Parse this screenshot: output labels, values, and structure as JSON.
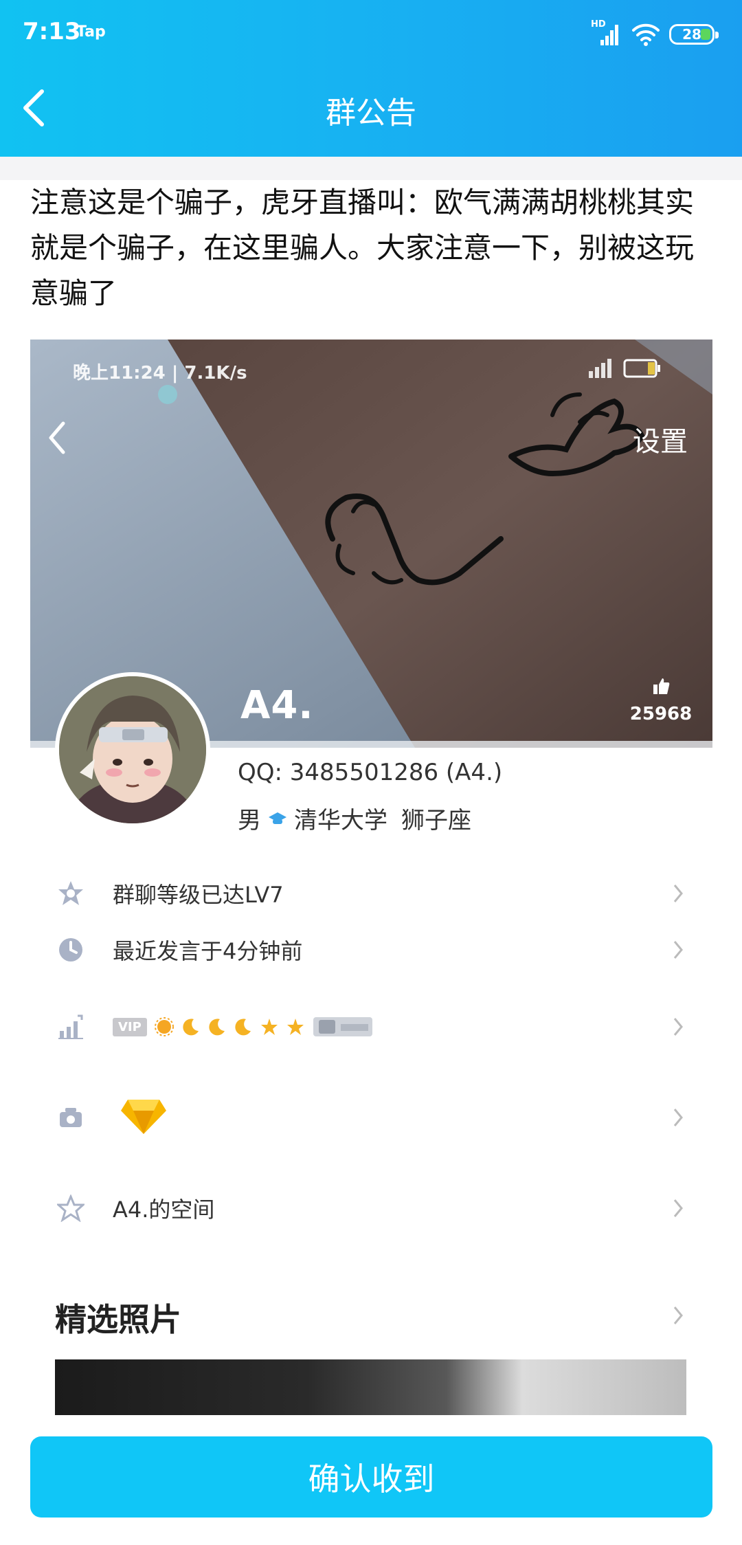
{
  "status_bar": {
    "time": "7:13",
    "app_tag": "Tap",
    "network_label": "HD",
    "battery": "28"
  },
  "header": {
    "title": "群公告",
    "back_icon": "chevron-left-icon",
    "background_color": "#17b3f2"
  },
  "notice": {
    "text": "注意这是个骗子，虎牙直播叫：欧气满满胡桃桃其实就是个骗子，在这里骗人。大家注意一下，别被这玩意骗了"
  },
  "screenshot": {
    "status_text": "晚上11:24 | 7.1K/s",
    "settings_label": "设置",
    "nickname": "A4.",
    "like_count": "25968",
    "qq_line": "QQ: 3485501286 (A4.)",
    "gender": "男",
    "school": "清华大学",
    "zodiac": "狮子座",
    "rows": [
      {
        "icon": "star-badge-icon",
        "label": "群聊等级已达LV7"
      },
      {
        "icon": "clock-icon",
        "label": "最近发言于4分钟前"
      },
      {
        "icon": "chart-up-icon",
        "label": "",
        "vip_tag": "VIP"
      },
      {
        "icon": "gift-box-icon",
        "label": "",
        "badge_icon": "diamond-icon"
      },
      {
        "icon": "star-outline-icon",
        "label": "A4.的空间"
      }
    ],
    "photos_section_title": "精选照片"
  },
  "footer": {
    "confirm_label": "确认收到",
    "button_color": "#10c6f7"
  }
}
